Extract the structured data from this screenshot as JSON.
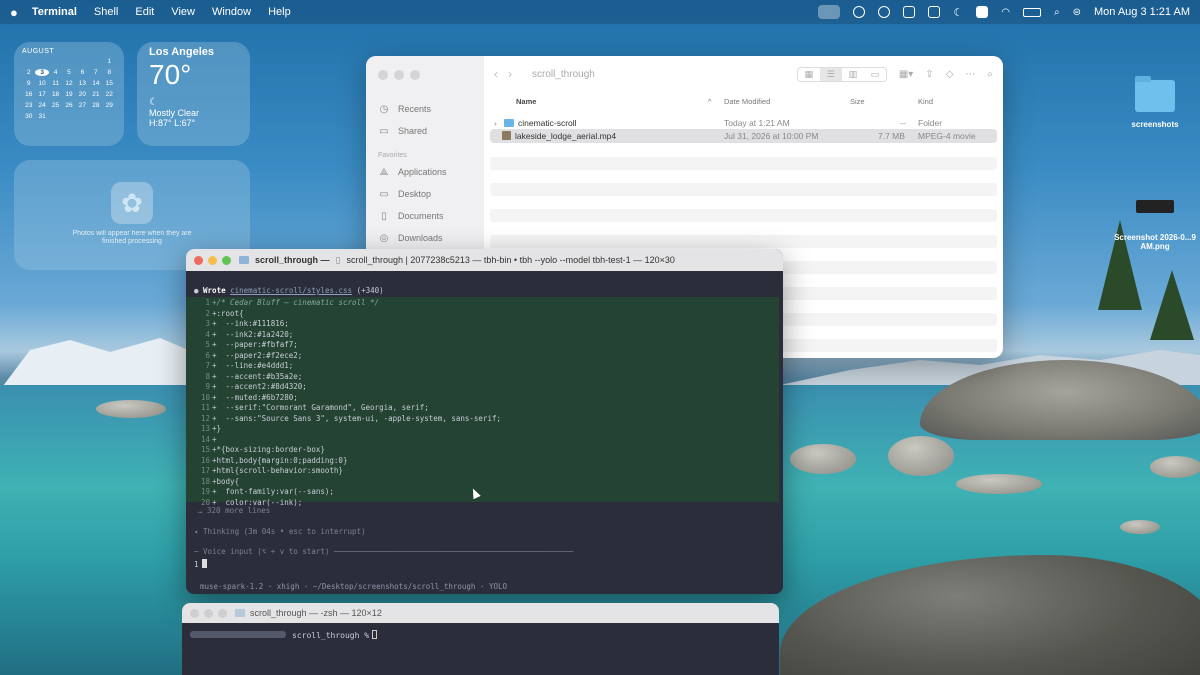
{
  "menubar": {
    "app": "Terminal",
    "menus": [
      "Shell",
      "Edit",
      "View",
      "Window",
      "Help"
    ],
    "clock": "Mon Aug 3  1:21 AM"
  },
  "calendar": {
    "month": "AUGUST",
    "rows": [
      [
        "",
        "",
        "",
        "",
        "",
        "",
        "1"
      ],
      [
        "2",
        "3",
        "4",
        "5",
        "6",
        "7",
        "8"
      ],
      [
        "9",
        "10",
        "11",
        "12",
        "13",
        "14",
        "15"
      ],
      [
        "16",
        "17",
        "18",
        "19",
        "20",
        "21",
        "22"
      ],
      [
        "23",
        "24",
        "25",
        "26",
        "27",
        "28",
        "29"
      ],
      [
        "30",
        "31",
        "",
        "",
        "",
        "",
        ""
      ]
    ],
    "today": "3"
  },
  "weather": {
    "city": "Los Angeles",
    "temp": "70°",
    "condition": "Mostly Clear",
    "hilo": "H:87° L:67°"
  },
  "photos_widget": {
    "text": "Photos will appear here when they are finished processing"
  },
  "desktop_icons": [
    {
      "label": "screenshots"
    },
    {
      "label": "Screenshot 2026-0...9 AM.png"
    }
  ],
  "finder": {
    "title": "scroll_through",
    "sidebar": {
      "top": [
        "Recents",
        "Shared"
      ],
      "favorites_header": "Favorites",
      "favorites": [
        "Applications",
        "Desktop",
        "Documents",
        "Downloads"
      ]
    },
    "columns": [
      "Name",
      "Date Modified",
      "Size",
      "Kind"
    ],
    "rows": [
      {
        "name": "cinematic-scroll",
        "date": "Today at 1:21 AM",
        "size": "--",
        "kind": "Folder",
        "type": "folder"
      },
      {
        "name": "lakeside_lodge_aerial.mp4",
        "date": "Jul 31, 2026 at 10:00 PM",
        "size": "7.7 MB",
        "kind": "MPEG-4 movie",
        "type": "movie"
      }
    ]
  },
  "terminal": {
    "tab": "scroll_through —",
    "title": "scroll_through | 2077238c5213 — tbh-bin • tbh --yolo --model tbh-test-1 — 120×30",
    "wrote_label": "Wrote",
    "wrote_file": "cinematic-scroll/styles.css",
    "wrote_count": "(+340)",
    "lines": [
      {
        "n": "1",
        "t": "+/* Cedar Bluff — cinematic scroll */",
        "comment": true
      },
      {
        "n": "2",
        "t": "+:root{"
      },
      {
        "n": "3",
        "t": "+  --ink:#111816;"
      },
      {
        "n": "4",
        "t": "+  --ink2:#1a2420;"
      },
      {
        "n": "5",
        "t": "+  --paper:#fbfaf7;"
      },
      {
        "n": "6",
        "t": "+  --paper2:#f2ece2;"
      },
      {
        "n": "7",
        "t": "+  --line:#e4ddd1;"
      },
      {
        "n": "8",
        "t": "+  --accent:#b35a2e;"
      },
      {
        "n": "9",
        "t": "+  --accent2:#8d4320;"
      },
      {
        "n": "10",
        "t": "+  --muted:#6b7280;"
      },
      {
        "n": "11",
        "t": "+  --serif:\"Cormorant Garamond\", Georgia, serif;"
      },
      {
        "n": "12",
        "t": "+  --sans:\"Source Sans 3\", system-ui, -apple-system, sans-serif;"
      },
      {
        "n": "13",
        "t": "+}"
      },
      {
        "n": "14",
        "t": "+"
      },
      {
        "n": "15",
        "t": "+*{box-sizing:border-box}"
      },
      {
        "n": "16",
        "t": "+html,body{margin:0;padding:0}"
      },
      {
        "n": "17",
        "t": "+html{scroll-behavior:smooth}"
      },
      {
        "n": "18",
        "t": "+body{"
      },
      {
        "n": "19",
        "t": "+  font-family:var(--sans);"
      },
      {
        "n": "20",
        "t": "+  color:var(--ink);"
      }
    ],
    "more": "… 320 more lines",
    "thinking": "✦ Thinking (3m 04s • esc to interrupt)",
    "voice": "─ Voice input (⌥ + v to start) ─────────────────────────────────────────────────────",
    "prompt": "1",
    "status": "muse-spark-1.2  ·  xhigh  ·  ~/Desktop/screenshots/scroll_through  ·  YOLO"
  },
  "terminal2": {
    "title": "scroll_through — -zsh — 120×12",
    "prompt": "scroll_through %"
  },
  "colors": {
    "diff_bg": "#244332",
    "terminal_bg": "#2b2d3a",
    "close": "#ed6a5e",
    "minimize": "#f5bf4f",
    "zoom": "#61c554"
  }
}
